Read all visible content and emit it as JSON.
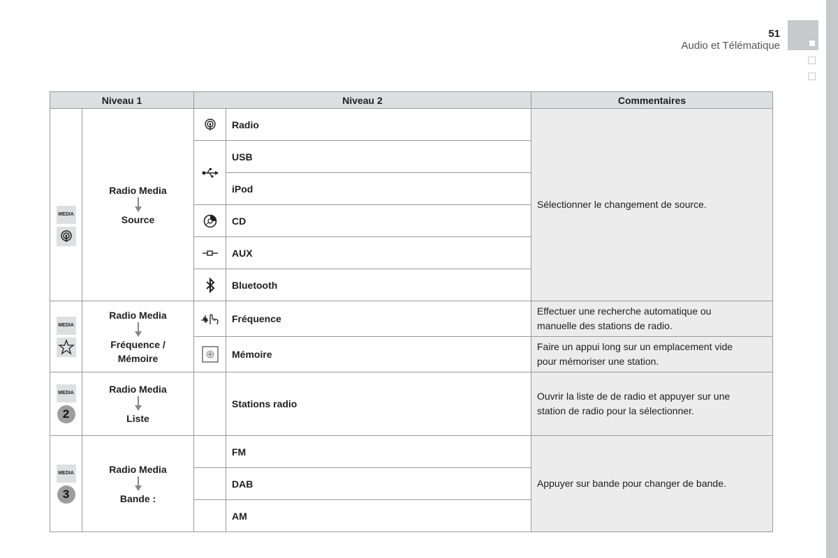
{
  "header": {
    "page_number": "51",
    "section_title": "Audio et Télématique"
  },
  "table": {
    "columns": [
      "Niveau 1",
      "Niveau 2",
      "Commentaires"
    ],
    "groups": [
      {
        "key_label": "MEDIA",
        "sub_icon": "radio-antenna-icon",
        "level1_top": "Radio Media",
        "level1_bottom": "Source",
        "comment": "Sélectionner le changement de source.",
        "items": [
          {
            "icon": "radio-antenna-icon",
            "label": "Radio"
          },
          {
            "icon": "usb-icon",
            "label": "USB"
          },
          {
            "icon": "usb-icon",
            "label": "iPod"
          },
          {
            "icon": "cd-icon",
            "label": "CD"
          },
          {
            "icon": "aux-jack-icon",
            "label": "AUX"
          },
          {
            "icon": "bluetooth-icon",
            "label": "Bluetooth"
          }
        ]
      },
      {
        "key_label": "MEDIA",
        "sub_icon": "star-icon",
        "level1_top": "Radio Media",
        "level1_bottom_1": "Fréquence /",
        "level1_bottom_2": "Mémoire",
        "items": [
          {
            "icon": "frequency-touch-icon",
            "label": "Fréquence",
            "comment_1": "Effectuer une recherche automatique ou",
            "comment_2": "manuelle des stations de radio."
          },
          {
            "icon": "add-memory-icon",
            "label": "Mémoire",
            "comment_1": "Faire un appui long sur un emplacement vide",
            "comment_2": "pour mémoriser une station."
          }
        ]
      },
      {
        "key_label": "MEDIA",
        "number": "2",
        "level1_top": "Radio Media",
        "level1_bottom": "Liste",
        "items": [
          {
            "label": "Stations radio",
            "comment_1": "Ouvrir la liste de de radio et appuyer sur une",
            "comment_2": "station de radio pour la sélectionner."
          }
        ]
      },
      {
        "key_label": "MEDIA",
        "number": "3",
        "level1_top": "Radio Media",
        "level1_bottom": "Bande :",
        "comment": "Appuyer sur bande pour changer de bande.",
        "items": [
          {
            "label": "FM"
          },
          {
            "label": "DAB"
          },
          {
            "label": "AM"
          }
        ]
      }
    ]
  }
}
